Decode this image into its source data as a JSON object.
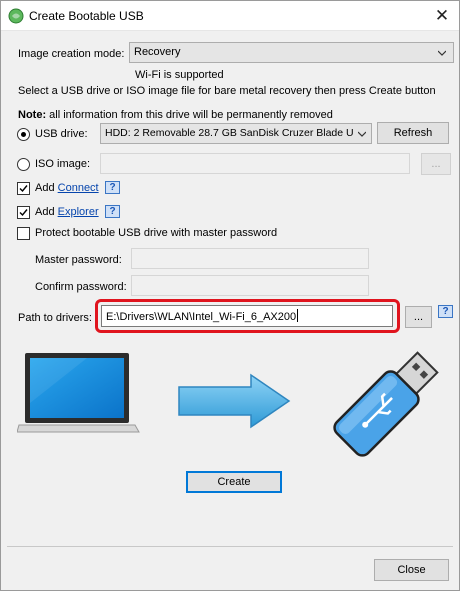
{
  "window": {
    "title": "Create Bootable USB",
    "close_glyph": "✕"
  },
  "mode": {
    "label": "Image creation mode:",
    "value": "Recovery",
    "note": "Wi-Fi is supported"
  },
  "instruction": "Select a USB drive or ISO image file for bare metal recovery then press Create button",
  "warning": {
    "bold": "Note:",
    "text": "all information from this drive will be permanently removed"
  },
  "usb": {
    "label": "USB drive:",
    "value": "HDD: 2 Removable 28.7 GB SanDisk Cruzer Blade U",
    "refresh": "Refresh",
    "selected": true
  },
  "iso": {
    "label": "ISO image:",
    "browse": "...",
    "selected": false
  },
  "options": {
    "add_prefix": "Add",
    "connect": "Connect",
    "explorer": "Explorer",
    "protect": "Protect bootable USB drive with master password",
    "help_glyph": "?"
  },
  "passwords": {
    "master_label": "Master password:",
    "confirm_label": "Confirm password:"
  },
  "drivers": {
    "label": "Path to drivers:",
    "value": "E:\\Drivers\\WLAN\\Intel_Wi-Fi_6_AX200",
    "browse": "..."
  },
  "actions": {
    "create": "Create",
    "close": "Close"
  },
  "icons": {
    "laptop": "laptop-icon",
    "arrow": "arrow-right-icon",
    "usb": "usb-drive-icon"
  },
  "colors": {
    "accent": "#0078d7",
    "highlight": "#e0141e",
    "link": "#0645ad"
  }
}
